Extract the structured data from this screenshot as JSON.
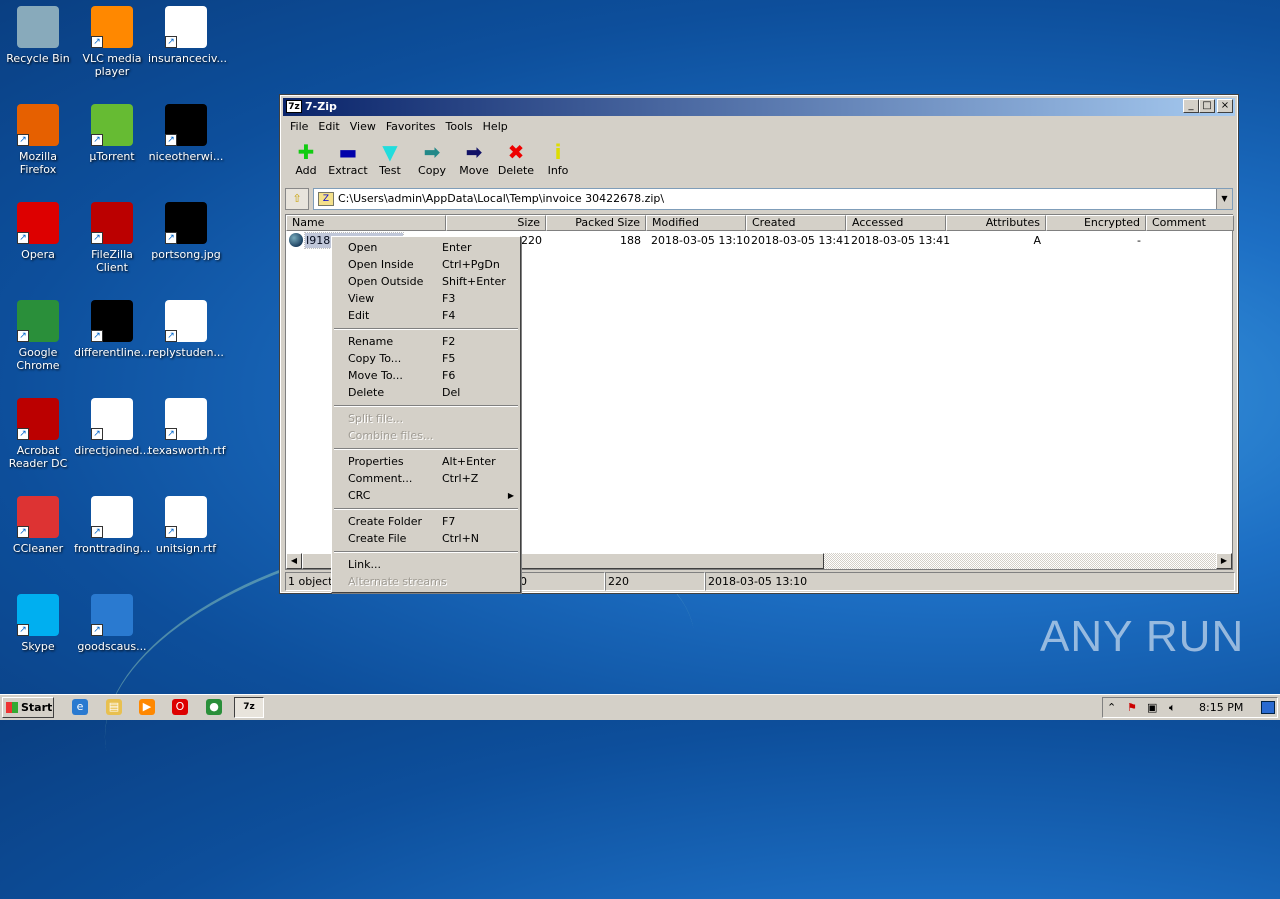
{
  "desktop": {
    "icons": [
      {
        "label": "Recycle Bin",
        "col": 0,
        "row": 0,
        "color": "#8ab"
      },
      {
        "label": "Mozilla Firefox",
        "col": 0,
        "row": 1,
        "color": "#e66000"
      },
      {
        "label": "Opera",
        "col": 0,
        "row": 2,
        "color": "#d00"
      },
      {
        "label": "Google Chrome",
        "col": 0,
        "row": 3,
        "color": "#2a8f3a"
      },
      {
        "label": "Acrobat Reader DC",
        "col": 0,
        "row": 4,
        "color": "#b00"
      },
      {
        "label": "CCleaner",
        "col": 0,
        "row": 5,
        "color": "#d33"
      },
      {
        "label": "Skype",
        "col": 0,
        "row": 6,
        "color": "#00aff0"
      },
      {
        "label": "VLC media player",
        "col": 1,
        "row": 0,
        "color": "#f80"
      },
      {
        "label": "µTorrent",
        "col": 1,
        "row": 1,
        "color": "#6b3"
      },
      {
        "label": "FileZilla Client",
        "col": 1,
        "row": 2,
        "color": "#b00"
      },
      {
        "label": "differentline...",
        "col": 1,
        "row": 3,
        "color": "#000"
      },
      {
        "label": "directjoined...",
        "col": 1,
        "row": 4,
        "color": "#fff"
      },
      {
        "label": "fronttrading...",
        "col": 1,
        "row": 5,
        "color": "#fff"
      },
      {
        "label": "goodscaus...",
        "col": 1,
        "row": 6,
        "color": "#2a7ad0"
      },
      {
        "label": "insuranceciv...",
        "col": 2,
        "row": 0,
        "color": "#fff"
      },
      {
        "label": "niceotherwi...",
        "col": 2,
        "row": 1,
        "color": "#000"
      },
      {
        "label": "portsong.jpg",
        "col": 2,
        "row": 2,
        "color": "#000"
      },
      {
        "label": "replystuden...",
        "col": 2,
        "row": 3,
        "color": "#fff"
      },
      {
        "label": "texasworth.rtf",
        "col": 2,
        "row": 4,
        "color": "#fff"
      },
      {
        "label": "unitsign.rtf",
        "col": 2,
        "row": 5,
        "color": "#fff"
      }
    ]
  },
  "window": {
    "title": "7-Zip",
    "app_icon": "7z",
    "menu": [
      "File",
      "Edit",
      "View",
      "Favorites",
      "Tools",
      "Help"
    ],
    "toolbar": [
      {
        "label": "Add",
        "glyph": "✚",
        "color": "#1c1"
      },
      {
        "label": "Extract",
        "glyph": "▬",
        "color": "#00a"
      },
      {
        "label": "Test",
        "glyph": "▼",
        "color": "#2dd"
      },
      {
        "label": "Copy",
        "glyph": "➡",
        "color": "#288"
      },
      {
        "label": "Move",
        "glyph": "➡",
        "color": "#116"
      },
      {
        "label": "Delete",
        "glyph": "✖",
        "color": "#e00"
      },
      {
        "label": "Info",
        "glyph": "i",
        "color": "#dd0"
      }
    ],
    "address": "C:\\Users\\admin\\AppData\\Local\\Temp\\invoice 30422678.zip\\",
    "columns": [
      "Name",
      "Size",
      "Packed Size",
      "Modified",
      "Created",
      "Accessed",
      "Attributes",
      "Encrypted",
      "Comment"
    ],
    "rows": [
      {
        "name": "I918",
        "size": "220",
        "packed": "188",
        "modified": "2018-03-05 13:10",
        "created": "2018-03-05 13:41",
        "accessed": "2018-03-05 13:41",
        "attributes": "A",
        "encrypted": "-",
        "comment": ""
      }
    ],
    "status": [
      "1 object(s) selected",
      "0",
      "220",
      "2018-03-05 13:10"
    ]
  },
  "context_menu": [
    [
      {
        "label": "Open",
        "key": "Enter"
      },
      {
        "label": "Open Inside",
        "key": "Ctrl+PgDn"
      },
      {
        "label": "Open Outside",
        "key": "Shift+Enter"
      },
      {
        "label": "View",
        "key": "F3"
      },
      {
        "label": "Edit",
        "key": "F4"
      }
    ],
    [
      {
        "label": "Rename",
        "key": "F2"
      },
      {
        "label": "Copy To...",
        "key": "F5"
      },
      {
        "label": "Move To...",
        "key": "F6"
      },
      {
        "label": "Delete",
        "key": "Del"
      }
    ],
    [
      {
        "label": "Split file...",
        "key": "",
        "disabled": true
      },
      {
        "label": "Combine files...",
        "key": "",
        "disabled": true
      }
    ],
    [
      {
        "label": "Properties",
        "key": "Alt+Enter"
      },
      {
        "label": "Comment...",
        "key": "Ctrl+Z"
      },
      {
        "label": "CRC",
        "key": "",
        "submenu": true
      }
    ],
    [
      {
        "label": "Create Folder",
        "key": "F7"
      },
      {
        "label": "Create File",
        "key": "Ctrl+N"
      }
    ],
    [
      {
        "label": "Link...",
        "key": ""
      },
      {
        "label": "Alternate streams",
        "key": "",
        "disabled": true
      }
    ]
  ],
  "taskbar": {
    "start": "Start",
    "quick": [
      {
        "name": "ie",
        "color": "#2a7ad0",
        "glyph": "e"
      },
      {
        "name": "explorer",
        "color": "#e8c050",
        "glyph": "▤"
      },
      {
        "name": "media-player",
        "color": "#f80",
        "glyph": "▶"
      },
      {
        "name": "opera",
        "color": "#d00",
        "glyph": "O"
      },
      {
        "name": "chrome",
        "color": "#2a8f3a",
        "glyph": "●"
      }
    ],
    "active_app": "7z",
    "clock": "8:15 PM"
  },
  "watermark": "ANY RUN"
}
